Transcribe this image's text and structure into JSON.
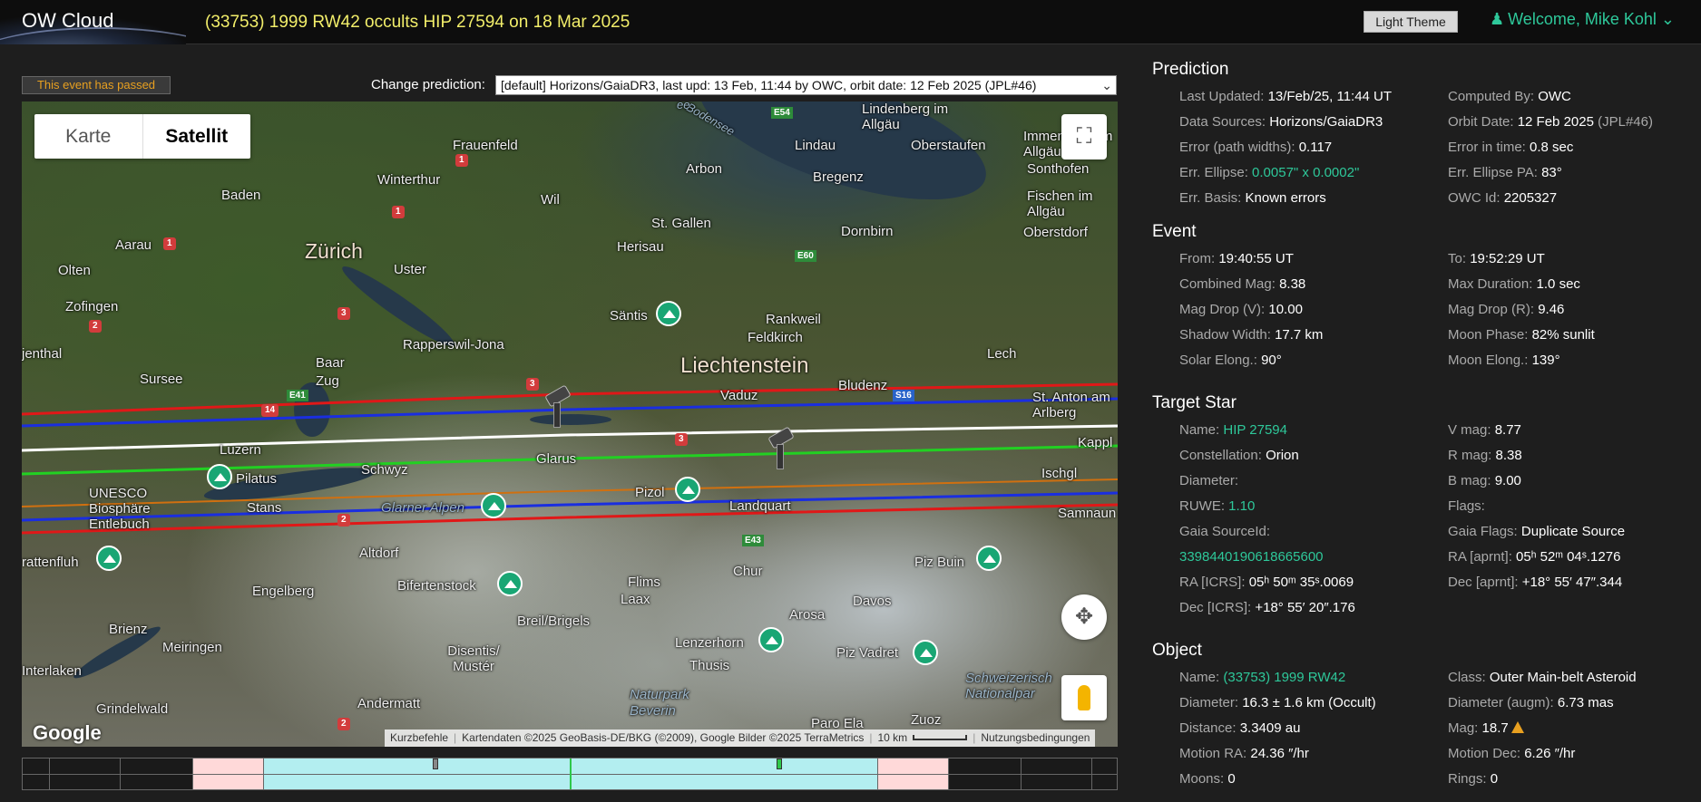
{
  "header": {
    "logo": "OW Cloud",
    "title": "(33753) 1999 RW42 occults HIP 27594 on 18 Mar 2025",
    "theme_button": "Light Theme",
    "welcome": "Welcome, Mike Kohl"
  },
  "toolbar": {
    "passed_badge": "This event has passed",
    "change_label": "Change prediction:",
    "prediction_selected": "[default] Horizons/GaiaDR3, last upd: 13 Feb, 11:44 by OWC, orbit date: 12 Feb 2025 (JPL#46)"
  },
  "map": {
    "type_options": [
      "Karte",
      "Satellit"
    ],
    "selected_type": "Satellit",
    "google": "Google",
    "attribution": {
      "shortcuts": "Kurzbefehle",
      "data": "Kartendaten ©2025 GeoBasis-DE/BKG (©2009), Google Bilder ©2025 TerraMetrics",
      "scale": "10 km",
      "terms": "Nutzungsbedingungen"
    },
    "places": {
      "zurich": "Zürich",
      "liechtenstein": "Liechtenstein",
      "frauenfeld": "Frauenfeld",
      "winterthur": "Winterthur",
      "baden": "Baden",
      "aarau": "Aarau",
      "olten": "Olten",
      "zofingen": "Zofingen",
      "uster": "Uster",
      "wil": "Wil",
      "arbon": "Arbon",
      "stgallen": "St. Gallen",
      "herisau": "Herisau",
      "lindau": "Lindau",
      "bregenz": "Bregenz",
      "dornbirn": "Dornbirn",
      "lindenberg": "Lindenberg im Allgäu",
      "oberstaufen": "Oberstaufen",
      "immenstadt": "Immenstadt im Allgäu",
      "sonthofen": "Sonthofen",
      "fischen": "Fischen im Allgäu",
      "oberstdorf": "Oberstdorf",
      "santis": "Säntis",
      "rankweil": "Rankweil",
      "feldkirch": "Feldkirch",
      "rapperswil": "Rapperswil-Jona",
      "baar": "Baar",
      "zug": "Zug",
      "sursee": "Sursee",
      "jenthal": "jenthal",
      "vaduz": "Vaduz",
      "bludenz": "Bludenz",
      "lech": "Lech",
      "stanton": "St. Anton am Arlberg",
      "luzern": "Luzern",
      "pilatus": "Pilatus",
      "schwyz": "Schwyz",
      "glarus": "Glarus",
      "kappl": "Kappl",
      "ischgl": "Ischgl",
      "samnaun": "Samnaun",
      "unesco": "UNESCO Biosphäre Entlebuch",
      "stans": "Stans",
      "glarner": "Glarner Alpen",
      "pizol": "Pizol",
      "landquart": "Landquart",
      "rattenfluh": "rattenfluh",
      "altdorf": "Altdorf",
      "engelberg": "Engelberg",
      "bifertenstock": "Bifertenstock",
      "flims": "Flims",
      "laax": "Laax",
      "chur": "Chur",
      "davos": "Davos",
      "pizbuin": "Piz Buin",
      "breil": "Breil/Brigels",
      "brienz": "Brienz",
      "meiringen": "Meiringen",
      "interlaken": "Interlaken",
      "disentis": "Disentis/ Mustér",
      "arosa": "Arosa",
      "lenzerhorn": "Lenzerhorn",
      "thusis": "Thusis",
      "pizvadret": "Piz Vadret",
      "schweizerisch": "Schweizerisch Nationalpar",
      "grindelwald": "Grindelwald",
      "andermatt": "Andermatt",
      "naturpark": "Naturpark Beverin",
      "zuoz": "Zuoz",
      "paro": "Paro Ela",
      "bodensee": "Bodensee",
      "ee": "ee"
    },
    "roads": {
      "r1a": "1",
      "r1b": "1",
      "r1c": "1",
      "r2a": "2",
      "r2b": "2",
      "r2c": "2",
      "r3a": "3",
      "r3b": "3",
      "r3c": "3",
      "r14": "14",
      "e41": "E41",
      "e43": "E43",
      "e54": "E54",
      "e60": "E60",
      "s16": "S16"
    }
  },
  "prediction": {
    "title": "Prediction",
    "rows": [
      {
        "k": "Last Updated:",
        "v": "13/Feb/25, 11:44 UT"
      },
      {
        "k": "Computed By:",
        "v": "OWC"
      },
      {
        "k": "Data Sources:",
        "v": "Horizons/GaiaDR3"
      },
      {
        "k": "Orbit Date:",
        "v": "12 Feb 2025",
        "v2": "(JPL#46)"
      },
      {
        "k": "Error (path widths):",
        "v": "0.117"
      },
      {
        "k": "Error in time:",
        "v": "0.8 sec"
      },
      {
        "k": "Err. Ellipse:",
        "v": "0.0057\" x 0.0002\""
      },
      {
        "k": "Err. Ellipse PA:",
        "v": "83°"
      },
      {
        "k": "Err. Basis:",
        "v": "Known errors"
      },
      {
        "k": "OWC Id:",
        "v": "2205327"
      }
    ]
  },
  "event": {
    "title": "Event",
    "rows": [
      {
        "k": "From:",
        "v": "19:40:55 UT"
      },
      {
        "k": "To:",
        "v": "19:52:29 UT"
      },
      {
        "k": "Combined Mag:",
        "v": "8.38"
      },
      {
        "k": "Max Duration:",
        "v": "1.0 sec"
      },
      {
        "k": "Mag Drop (V):",
        "v": "10.00"
      },
      {
        "k": "Mag Drop (R):",
        "v": "9.46"
      },
      {
        "k": "Shadow Width:",
        "v": "17.7 km"
      },
      {
        "k": "Moon Phase:",
        "v": "82% sunlit"
      },
      {
        "k": "Solar Elong.:",
        "v": "90°"
      },
      {
        "k": "Moon Elong.:",
        "v": "139°"
      }
    ]
  },
  "star": {
    "title": "Target Star",
    "rows": [
      {
        "k": "Name:",
        "v": "HIP 27594"
      },
      {
        "k": "V mag:",
        "v": "8.77"
      },
      {
        "k": "Constellation:",
        "v": "Orion"
      },
      {
        "k": "R mag:",
        "v": "8.38"
      },
      {
        "k": "Diameter:",
        "v": ""
      },
      {
        "k": "B mag:",
        "v": "9.00"
      },
      {
        "k": "RUWE:",
        "v": "1.10"
      },
      {
        "k": "Flags:",
        "v": ""
      },
      {
        "k": "Gaia SourceId:",
        "v": ""
      },
      {
        "k": "Gaia Flags:",
        "v": "Duplicate Source"
      },
      {
        "k": "",
        "v": "3398440190618665600"
      },
      {
        "k": "RA [aprnt]:",
        "v": "05ʰ 52ᵐ 04ˢ.1276"
      },
      {
        "k": "RA [ICRS]:",
        "v": "05ʰ 50ᵐ 35ˢ.0069"
      },
      {
        "k": "Dec [aprnt]:",
        "v": "+18° 55′ 47″.344"
      },
      {
        "k": "Dec [ICRS]:",
        "v": "+18° 55′ 20″.176"
      }
    ]
  },
  "object": {
    "title": "Object",
    "rows": [
      {
        "k": "Name:",
        "v": "(33753) 1999 RW42"
      },
      {
        "k": "Class:",
        "v": "Outer Main-belt Asteroid"
      },
      {
        "k": "Diameter:",
        "v": "16.3 ± 1.6 km",
        "v2": "(Occult)"
      },
      {
        "k": "Diameter (augm):",
        "v": "6.73 mas"
      },
      {
        "k": "Distance:",
        "v": "3.3409 au"
      },
      {
        "k": "Mag:",
        "v": "18.7"
      },
      {
        "k": "Motion RA:",
        "v": "24.36 ″/hr"
      },
      {
        "k": "Motion Dec:",
        "v": "6.26 ″/hr"
      },
      {
        "k": "Moons:",
        "v": "0"
      },
      {
        "k": "Rings:",
        "v": "0"
      }
    ]
  },
  "colors": {
    "title_yellow": "#f2ee6a",
    "accent_teal": "#2ec89a",
    "warning": "#e8a020",
    "path_red": "#e01818",
    "path_blue": "#1a2ee0",
    "path_white": "#ffffff",
    "path_green": "#22d022",
    "path_orange": "#d07010"
  }
}
